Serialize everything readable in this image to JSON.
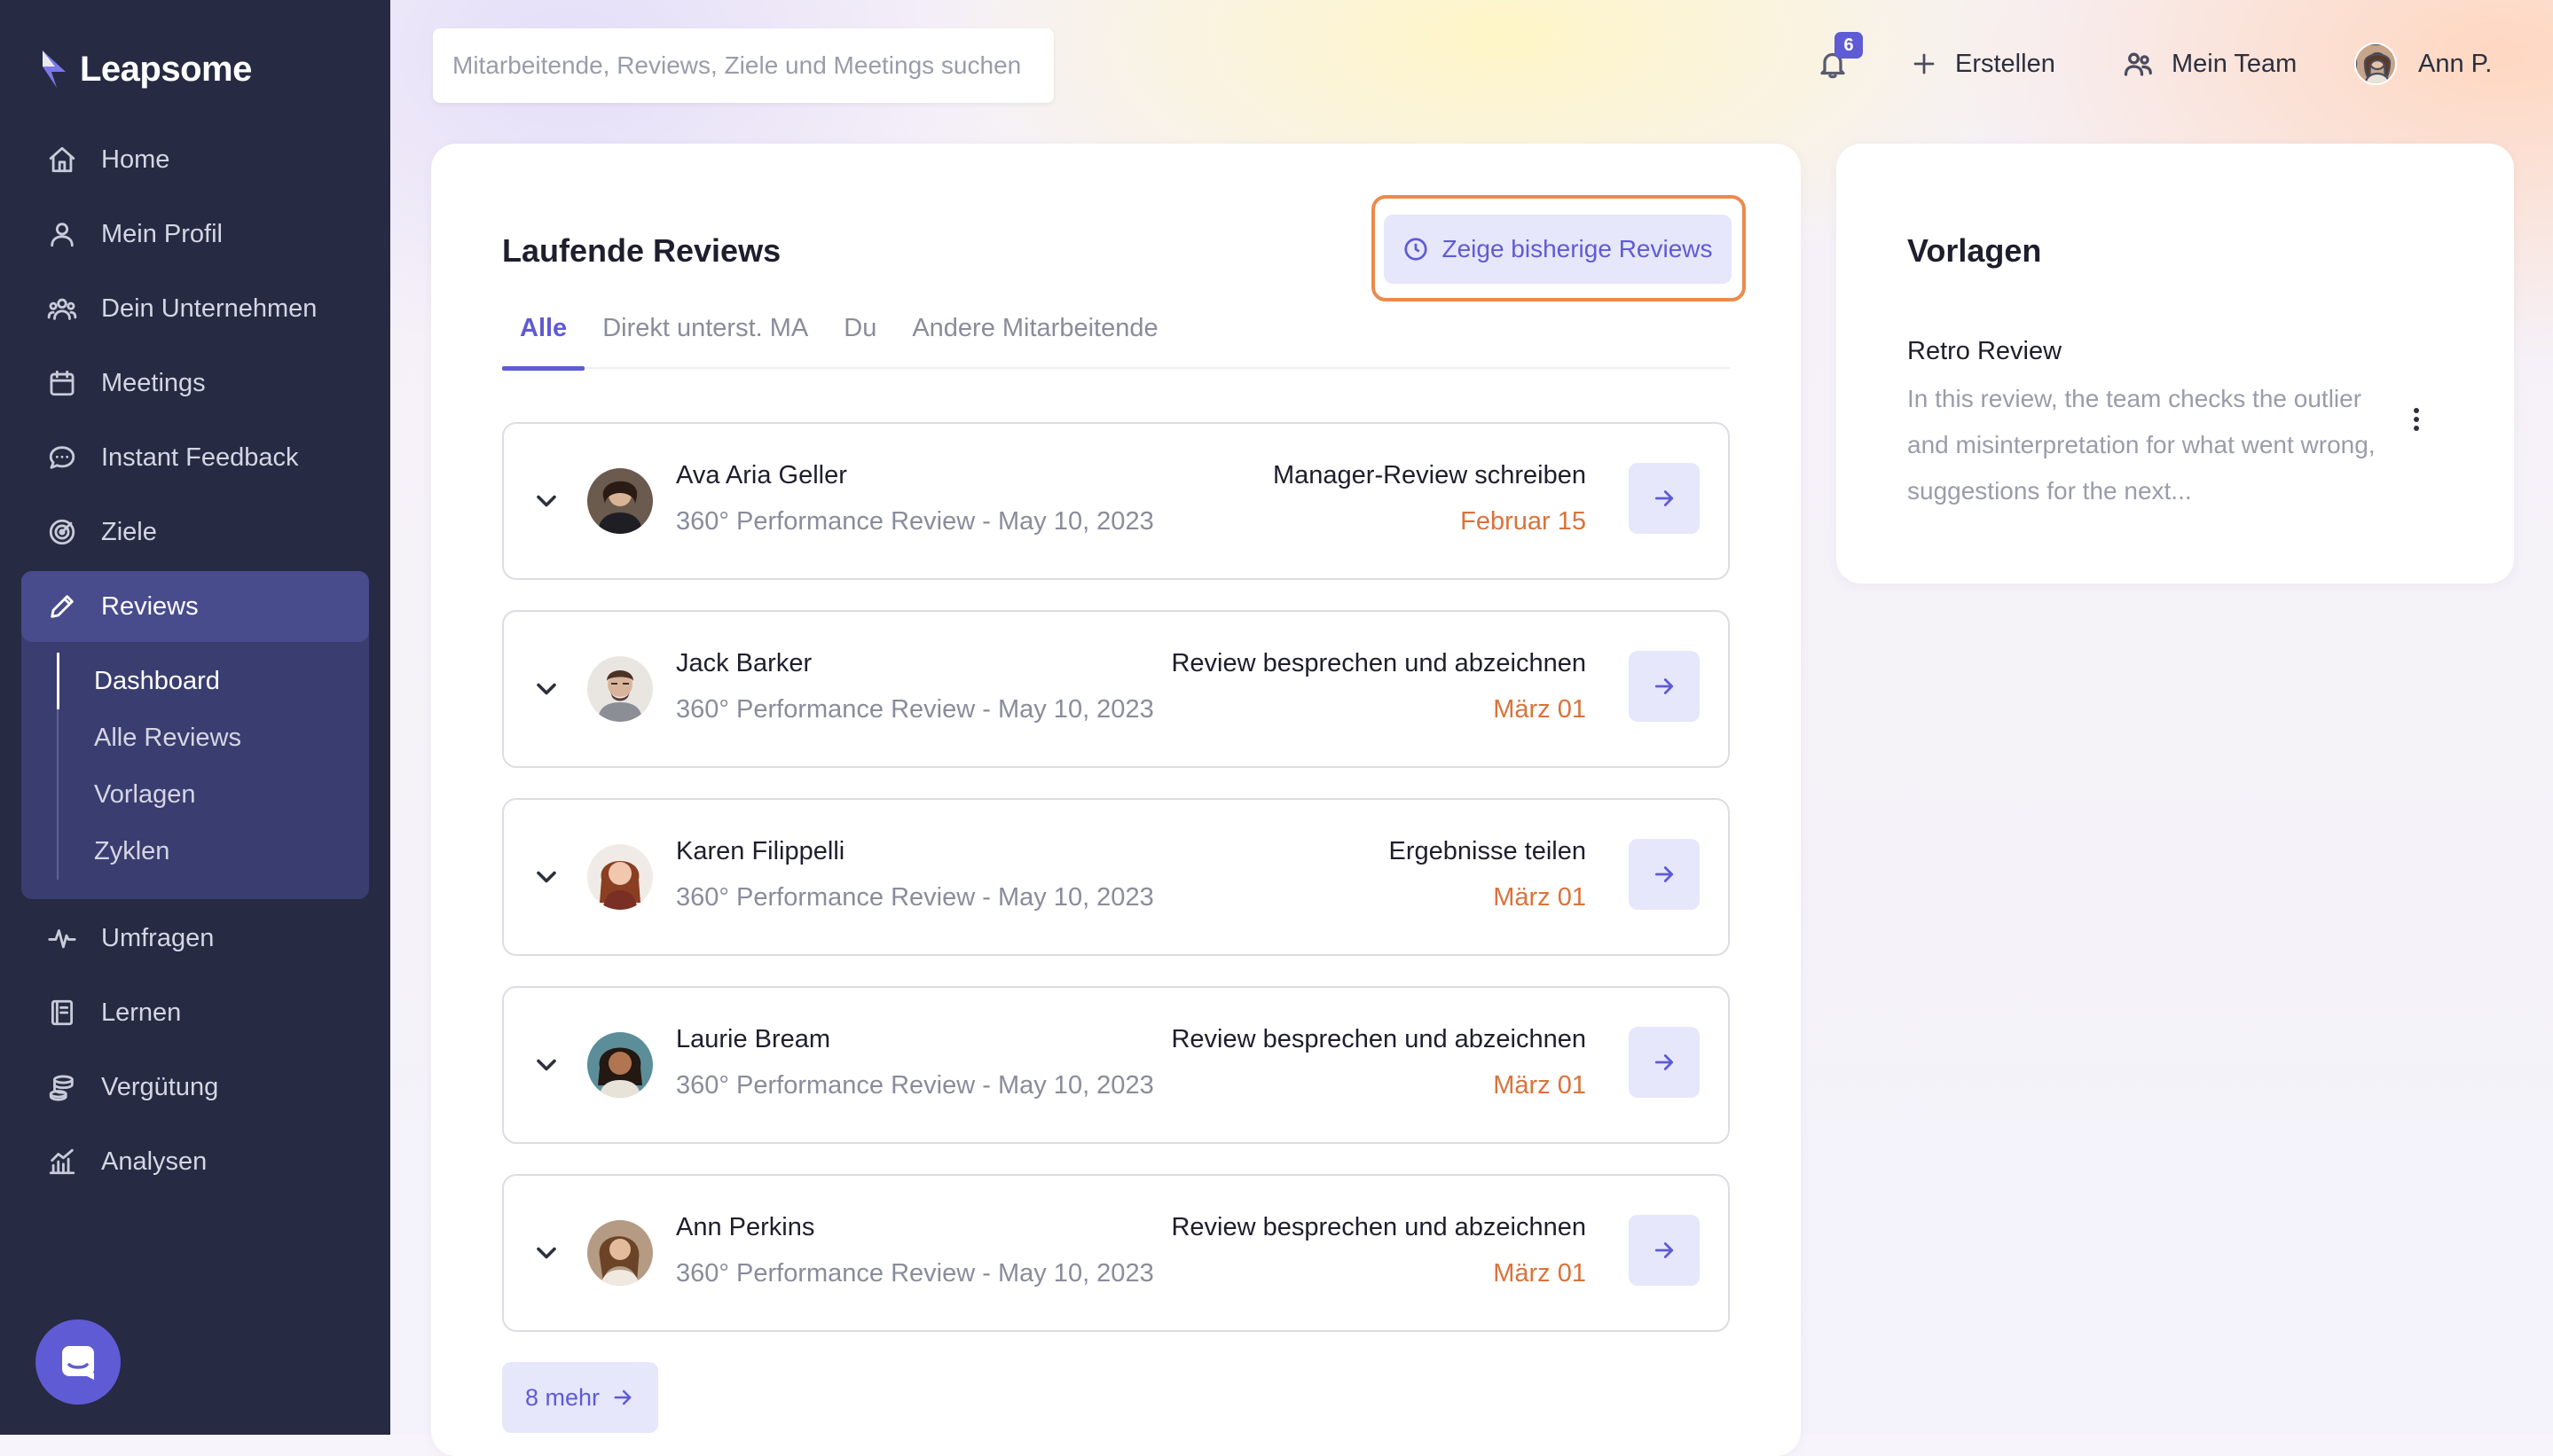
{
  "brand": {
    "name": "Leapsome"
  },
  "sidebar": {
    "items": [
      {
        "label": "Home",
        "icon": "home-icon"
      },
      {
        "label": "Mein Profil",
        "icon": "user-icon"
      },
      {
        "label": "Dein Unternehmen",
        "icon": "users-icon"
      },
      {
        "label": "Meetings",
        "icon": "calendar-icon"
      },
      {
        "label": "Instant Feedback",
        "icon": "chat-icon"
      },
      {
        "label": "Ziele",
        "icon": "target-icon"
      }
    ],
    "reviews": {
      "label": "Reviews",
      "icon": "pencil-icon",
      "subitems": [
        "Dashboard",
        "Alle Reviews",
        "Vorlagen",
        "Zyklen"
      ],
      "current_subitem": "Dashboard"
    },
    "items_after": [
      {
        "label": "Umfragen",
        "icon": "pulse-icon"
      },
      {
        "label": "Lernen",
        "icon": "book-icon"
      },
      {
        "label": "Vergütung",
        "icon": "coins-icon"
      },
      {
        "label": "Analysen",
        "icon": "analytics-icon"
      }
    ]
  },
  "topbar": {
    "search_placeholder": "Mitarbeitende, Reviews, Ziele und Meetings suchen",
    "notification_count": "6",
    "create_label": "Erstellen",
    "team_label": "Mein Team",
    "user_name": "Ann P."
  },
  "reviews_panel": {
    "title": "Laufende Reviews",
    "history_button": "Zeige bisherige Reviews",
    "tabs": [
      "Alle",
      "Direkt unterst. MA",
      "Du",
      "Andere Mitarbeitende"
    ],
    "active_tab": "Alle",
    "rows": [
      {
        "name": "Ava Aria Geller",
        "review": "360° Performance Review - May 10, 2023",
        "action": "Manager-Review schreiben",
        "due": "Februar 15"
      },
      {
        "name": "Jack Barker",
        "review": "360° Performance Review - May 10, 2023",
        "action": "Review besprechen und abzeichnen",
        "due": "März 01"
      },
      {
        "name": "Karen Filippelli",
        "review": "360° Performance Review - May 10, 2023",
        "action": "Ergebnisse teilen",
        "due": "März 01"
      },
      {
        "name": "Laurie Bream",
        "review": "360° Performance Review - May 10, 2023",
        "action": "Review besprechen und abzeichnen",
        "due": "März 01"
      },
      {
        "name": "Ann Perkins",
        "review": "360° Performance Review - May 10, 2023",
        "action": "Review besprechen und abzeichnen",
        "due": "März 01"
      }
    ],
    "more_label": "8 mehr"
  },
  "templates_panel": {
    "title": "Vorlagen",
    "template_name": "Retro Review",
    "template_description": "In this review, the team checks the outlier and misinterpretation for what went wrong, suggestions for the next..."
  },
  "colors": {
    "sidebar_bg": "#262a42",
    "sidebar_active": "#484b8c",
    "accent": "#5f5bd4",
    "due_date": "#d9733a",
    "highlight_outline": "#ec8a4c"
  }
}
